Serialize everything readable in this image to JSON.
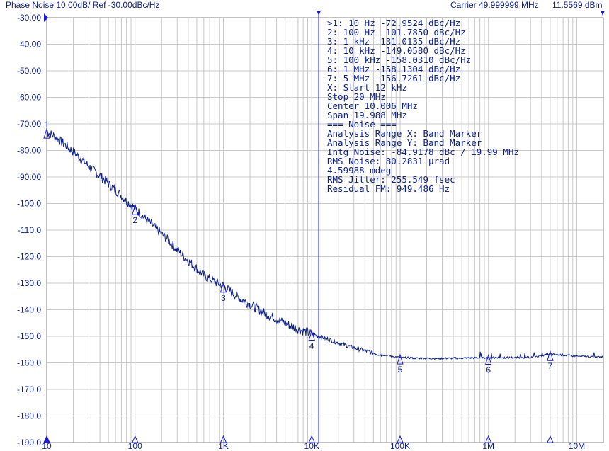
{
  "header": {
    "title": "Phase Noise 10.00dB/ Ref -30.00dBc/Hz",
    "carrier": "Carrier 49.999999 MHz",
    "carrier_level": "11.5569 dBm"
  },
  "colors": {
    "trace": "#0b1f8c",
    "grid": "#c8c8c8",
    "frame": "#808080",
    "marker_line": "#1a1acc"
  },
  "chart_data": {
    "type": "line",
    "x_scale": "log",
    "xlim": [
      10,
      20000000
    ],
    "ylim": [
      -190,
      -30
    ],
    "grid": true,
    "y_ticks": [
      "-30.00",
      "-40.00",
      "-50.00",
      "-60.00",
      "-70.00",
      "-80.00",
      "-90.00",
      "-100.0",
      "-110.0",
      "-120.0",
      "-130.0",
      "-140.0",
      "-150.0",
      "-160.0",
      "-170.0",
      "-180.0",
      "-190.0"
    ],
    "x_ticks": [
      {
        "x": 10,
        "label": "10"
      },
      {
        "x": 100,
        "label": "100"
      },
      {
        "x": 1000,
        "label": "1K"
      },
      {
        "x": 10000,
        "label": "10K"
      },
      {
        "x": 100000,
        "label": "100K"
      },
      {
        "x": 1000000,
        "label": "1M"
      },
      {
        "x": 10000000,
        "label": "10M"
      }
    ],
    "series": [
      {
        "x": [
          10,
          12,
          15,
          20,
          25,
          30,
          40,
          50,
          60,
          70,
          80,
          100,
          120,
          150,
          200,
          250,
          300,
          400,
          500,
          600,
          800,
          1000,
          1500,
          2000,
          3000,
          5000,
          7000,
          10000,
          15000,
          20000,
          30000,
          50000,
          70000,
          100000,
          150000,
          200000,
          300000,
          500000,
          700000,
          1000000,
          2000000,
          3000000,
          5000000,
          10000000,
          20000000
        ],
        "y": [
          -72.95,
          -74.5,
          -77.0,
          -80.5,
          -83.5,
          -86.0,
          -89.5,
          -92.5,
          -95.0,
          -97.0,
          -99.0,
          -101.8,
          -104.5,
          -107.5,
          -111.5,
          -114.5,
          -117.5,
          -121.5,
          -124.5,
          -127.0,
          -129.5,
          -131.0,
          -135.5,
          -138.0,
          -141.5,
          -145.0,
          -147.3,
          -149.1,
          -151.0,
          -152.5,
          -154.3,
          -156.3,
          -157.2,
          -158.0,
          -158.2,
          -158.3,
          -158.3,
          -158.2,
          -158.1,
          -158.1,
          -158.0,
          -157.9,
          -156.7,
          -157.5,
          -157.8
        ]
      }
    ],
    "markers": [
      {
        "id": "1",
        "x": 10,
        "y": -72.9524
      },
      {
        "id": "2",
        "x": 100,
        "y": -101.785
      },
      {
        "id": "3",
        "x": 1000,
        "y": -131.0135
      },
      {
        "id": "4",
        "x": 10000,
        "y": -149.058
      },
      {
        "id": "5",
        "x": 100000,
        "y": -158.031
      },
      {
        "id": "6",
        "x": 1000000,
        "y": -158.1304
      },
      {
        "id": "7",
        "x": 5000000,
        "y": -156.7261
      }
    ],
    "band_start": 12000,
    "band_end": 20000000
  },
  "marker_table": [
    ">1:  10 Hz      -72.9524  dBc/Hz",
    " 2:  100 Hz    -101.7850  dBc/Hz",
    " 3:  1 kHz     -131.0135  dBc/Hz",
    " 4:  10 kHz    -149.0580  dBc/Hz",
    " 5:  100 kHz   -158.0310  dBc/Hz",
    " 6:  1 MHz     -158.1304  dBc/Hz",
    " 7:  5 MHz     -156.7261  dBc/Hz",
    " X: Start 12 kHz",
    "      Stop 20 MHz",
    "    Center 10.006 MHz",
    "      Span 19.988 MHz",
    "=== Noise ===",
    "Analysis Range X: Band Marker",
    "Analysis Range Y: Band Marker",
    "Intg Noise: -84.9178 dBc / 19.99 MHz",
    " RMS Noise: 80.2831 µrad",
    "            4.59988 mdeg",
    "RMS Jitter: 255.549 fsec",
    "Residual FM: 949.486 Hz"
  ]
}
